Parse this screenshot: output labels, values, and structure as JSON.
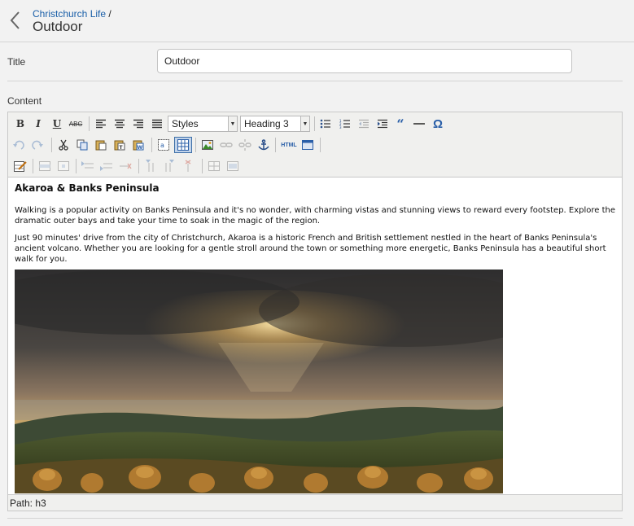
{
  "header": {
    "breadcrumb_parent": "Christchurch Life",
    "breadcrumb_sep": "/",
    "page_title": "Outdoor"
  },
  "form": {
    "title_label": "Title",
    "title_value": "Outdoor",
    "content_label": "Content"
  },
  "toolbar": {
    "bold": "B",
    "italic": "I",
    "underline": "U",
    "strike": "ABC",
    "styles_value": "Styles",
    "format_value": "Heading 3",
    "blockquote": "“",
    "omega": "Ω",
    "html_label": "HTML"
  },
  "content": {
    "heading": "Akaroa & Banks Peninsula",
    "para1": "Walking is a popular activity on Banks Peninsula and it's no wonder, with charming vistas and stunning views to reward every footstep. Explore the dramatic outer bays and take your time to soak in the magic of the region.",
    "para2": "Just 90 minutes' drive from the city of Christchurch, Akaroa is a historic French and British settlement nestled in the heart of Banks Peninsula's ancient volcano. Whether you are looking for a gentle stroll around the town or something more energetic, Banks Peninsula has a beautiful short walk for you.",
    "image_subject": "sunset-over-hills-photo"
  },
  "statusbar": {
    "path": "Path: h3"
  },
  "colors": {
    "link": "#1a5fa8",
    "active_button": "#c2d4ea"
  }
}
